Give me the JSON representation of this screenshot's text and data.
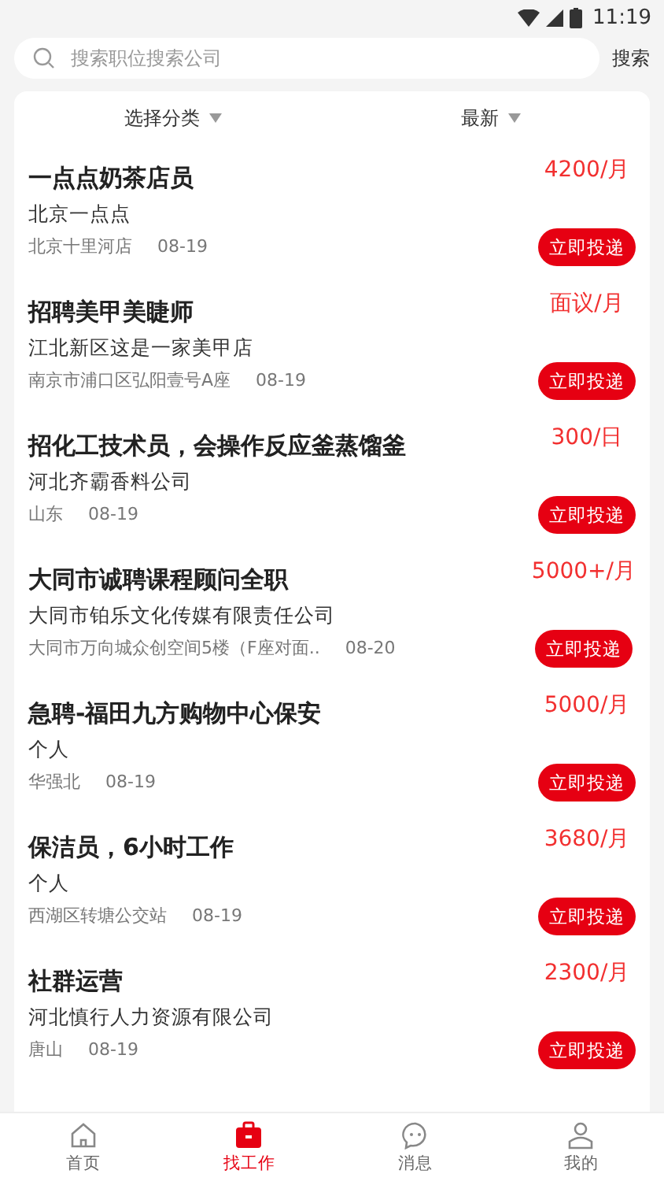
{
  "status_bar": {
    "time": "11:19"
  },
  "search": {
    "placeholder": "搜索职位搜索公司",
    "button": "搜索"
  },
  "filters": [
    {
      "label": "选择分类"
    },
    {
      "label": "最新"
    }
  ],
  "jobs": [
    {
      "title": "一点点奶茶店员",
      "salary": "4200/月",
      "company": "北京一点点",
      "location": "北京十里河店",
      "date": "08-19",
      "action": "立即投递"
    },
    {
      "title": "招聘美甲美睫师",
      "salary": "面议/月",
      "company": "江北新区这是一家美甲店",
      "location": "南京市浦口区弘阳壹号A座",
      "date": "08-19",
      "action": "立即投递"
    },
    {
      "title": "招化工技术员，会操作反应釜蒸馏釜",
      "salary": "300/日",
      "company": "河北齐霸香料公司",
      "location": "山东",
      "date": "08-19",
      "action": "立即投递"
    },
    {
      "title": "大同市诚聘课程顾问全职",
      "salary": "5000+/月",
      "company": "大同市铂乐文化传媒有限责任公司",
      "location": "大同市万向城众创空间5楼（F座对面..",
      "date": "08-20",
      "action": "立即投递"
    },
    {
      "title": "急聘-福田九方购物中心保安",
      "salary": "5000/月",
      "company": "个人",
      "location": "华强北",
      "date": "08-19",
      "action": "立即投递"
    },
    {
      "title": "保洁员，6小时工作",
      "salary": "3680/月",
      "company": "个人",
      "location": "西湖区转塘公交站",
      "date": "08-19",
      "action": "立即投递"
    },
    {
      "title": "社群运营",
      "salary": "2300/月",
      "company": "河北慎行人力资源有限公司",
      "location": "唐山",
      "date": "08-19",
      "action": "立即投递"
    }
  ],
  "tab_bar": [
    {
      "label": "首页",
      "kind": "home",
      "selected": false
    },
    {
      "label": "找工作",
      "kind": "briefcase",
      "selected": true
    },
    {
      "label": "消息",
      "kind": "chat",
      "selected": false
    },
    {
      "label": "我的",
      "kind": "person",
      "selected": false
    }
  ]
}
